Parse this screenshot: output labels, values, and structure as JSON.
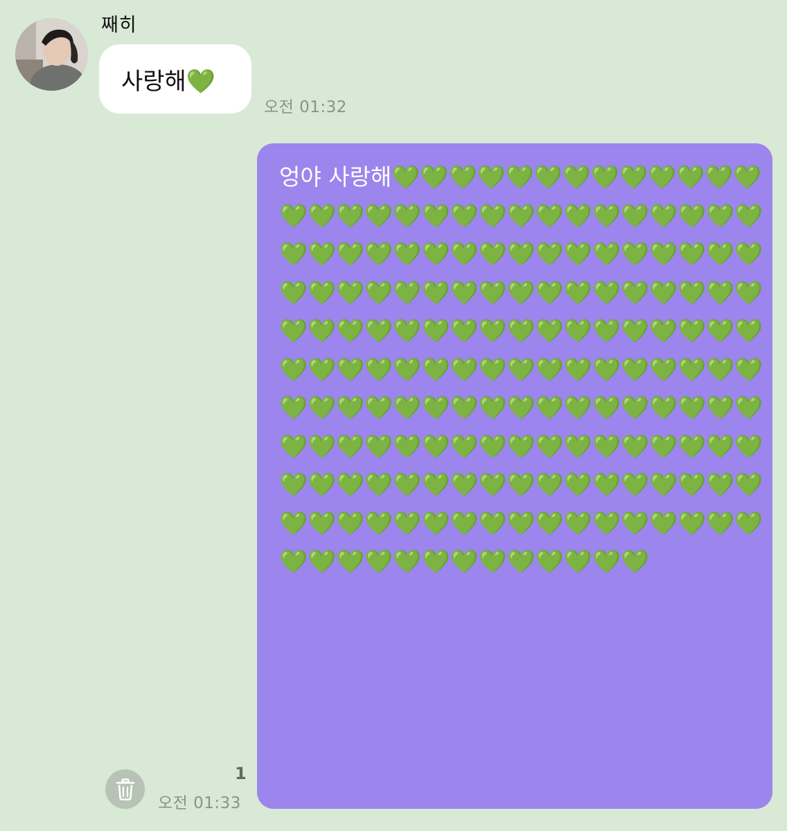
{
  "received": {
    "sender_name": "째히",
    "message": "사랑해💚",
    "time": "오전 01:32"
  },
  "sent": {
    "message": "엉야 사랑해💚💚💚💚💚💚💚💚💚💚💚💚💚💚💚💚💚💚💚💚💚💚💚💚💚💚💚💚💚💚💚💚💚💚💚💚💚💚💚💚💚💚💚💚💚💚💚💚💚💚💚💚💚💚💚💚💚💚💚💚💚💚💚💚💚💚💚💚💚💚💚💚💚💚💚💚💚💚💚💚💚💚💚💚💚💚💚💚💚💚💚💚💚💚💚💚💚💚💚💚💚💚💚💚💚💚💚💚💚💚💚💚💚💚💚💚💚💚💚💚💚💚💚💚💚💚💚💚💚💚💚💚💚💚💚💚💚💚💚💚💚💚💚💚💚💚💚💚💚💚💚💚💚💚💚💚💚💚💚💚💚💚💚💚💚💚💚💚💚💚💚💚💚💚💚💚💚💚💚",
    "read_count": "1",
    "time": "오전 01:33"
  },
  "icons": {
    "avatar": "profile-photo",
    "delete": "trash-icon"
  },
  "colors": {
    "background": "#d8e9d5",
    "sent_bubble": "#9c85ec",
    "received_bubble": "#ffffff",
    "heart": "#5ec93f"
  }
}
